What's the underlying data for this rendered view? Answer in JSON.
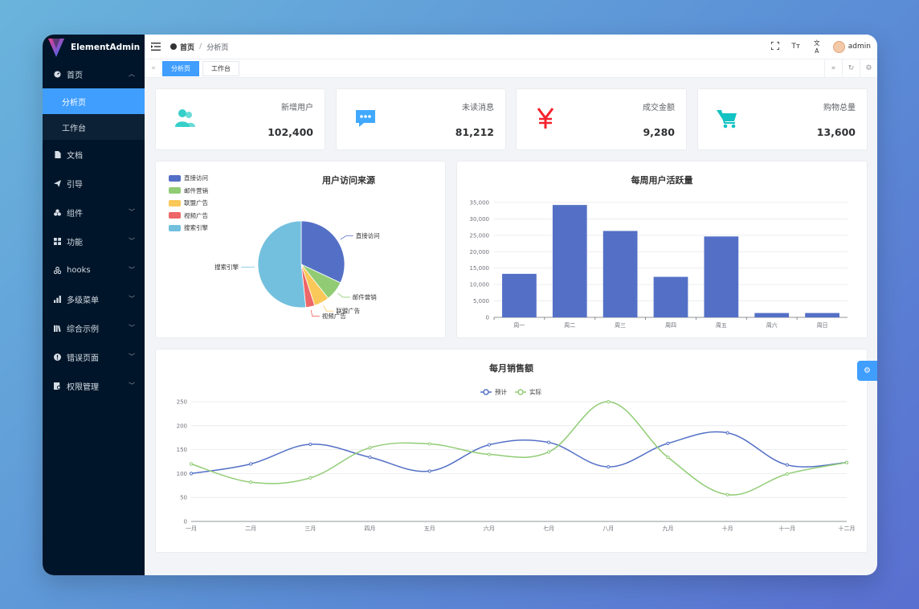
{
  "app": {
    "title": "ElementAdmin"
  },
  "sidebar": {
    "items": [
      {
        "label": "首页",
        "icon": "dashboard-icon",
        "expanded": true
      },
      {
        "label": "文档",
        "icon": "document-icon"
      },
      {
        "label": "引导",
        "icon": "send-icon"
      },
      {
        "label": "组件",
        "icon": "components-icon"
      },
      {
        "label": "功能",
        "icon": "grid-icon"
      },
      {
        "label": "hooks",
        "icon": "hooks-icon"
      },
      {
        "label": "多级菜单",
        "icon": "bar-chart-icon"
      },
      {
        "label": "综合示例",
        "icon": "library-icon"
      },
      {
        "label": "错误页面",
        "icon": "error-icon"
      },
      {
        "label": "权限管理",
        "icon": "lock-user-icon"
      }
    ],
    "subitems": [
      {
        "label": "分析页",
        "active": true
      },
      {
        "label": "工作台",
        "active": false
      }
    ]
  },
  "header": {
    "breadcrumb_home": "首页",
    "breadcrumb_current": "分析页",
    "username": "admin",
    "font_icon_text": "Tт",
    "lang_icon_text": "文A"
  },
  "tabs": [
    {
      "label": "分析页",
      "active": true
    },
    {
      "label": "工作台",
      "active": false
    }
  ],
  "stats": [
    {
      "label": "新增用户",
      "value": "102,400",
      "icon": "users-icon",
      "color": "#36cfc9"
    },
    {
      "label": "未读消息",
      "value": "81,212",
      "icon": "message-icon",
      "color": "#40a9ff"
    },
    {
      "label": "成交金额",
      "value": "9,280",
      "icon": "yen-icon",
      "color": "#f5222d"
    },
    {
      "label": "购物总量",
      "value": "13,600",
      "icon": "cart-icon",
      "color": "#13c2c2"
    }
  ],
  "charts": {
    "pie_title": "用户访问来源",
    "bar_title": "每周用户活跃量",
    "line_title": "每月销售额"
  },
  "chart_data": [
    {
      "type": "pie",
      "title": "用户访问来源",
      "legend_position": "top-left",
      "slices": [
        {
          "name": "直接访问",
          "value": 320,
          "color": "#5470c6"
        },
        {
          "name": "邮件营销",
          "value": 73,
          "color": "#91cc75"
        },
        {
          "name": "联盟广告",
          "value": 57,
          "color": "#fac858"
        },
        {
          "name": "视频广告",
          "value": 33,
          "color": "#ee6666"
        },
        {
          "name": "搜索引擎",
          "value": 517,
          "color": "#73c0de"
        }
      ]
    },
    {
      "type": "bar",
      "title": "每周用户活跃量",
      "categories": [
        "周一",
        "周二",
        "周三",
        "周四",
        "周五",
        "周六",
        "周日"
      ],
      "values": [
        13253,
        34235,
        26321,
        12340,
        24643,
        1322,
        1324
      ],
      "ylim": [
        0,
        35000
      ],
      "yticks": [
        "0",
        "5,000",
        "10,000",
        "15,000",
        "20,000",
        "25,000",
        "30,000",
        "35,000"
      ],
      "color": "#5470c6",
      "grid": true
    },
    {
      "type": "line",
      "title": "每月销售额",
      "legend_position": "top-center",
      "categories": [
        "一月",
        "二月",
        "三月",
        "四月",
        "五月",
        "六月",
        "七月",
        "八月",
        "九月",
        "十月",
        "十一月",
        "十二月"
      ],
      "ylim": [
        0,
        250
      ],
      "yticks": [
        "0",
        "50",
        "100",
        "150",
        "200",
        "250"
      ],
      "series": [
        {
          "name": "预计",
          "color": "#5470c6",
          "values": [
            100,
            120,
            161,
            134,
            105,
            160,
            165,
            114,
            163,
            185,
            118,
            123
          ]
        },
        {
          "name": "实际",
          "color": "#91cc75",
          "values": [
            120,
            82,
            91,
            154,
            162,
            140,
            145,
            250,
            134,
            56,
            99,
            123
          ]
        }
      ],
      "grid": true
    }
  ]
}
